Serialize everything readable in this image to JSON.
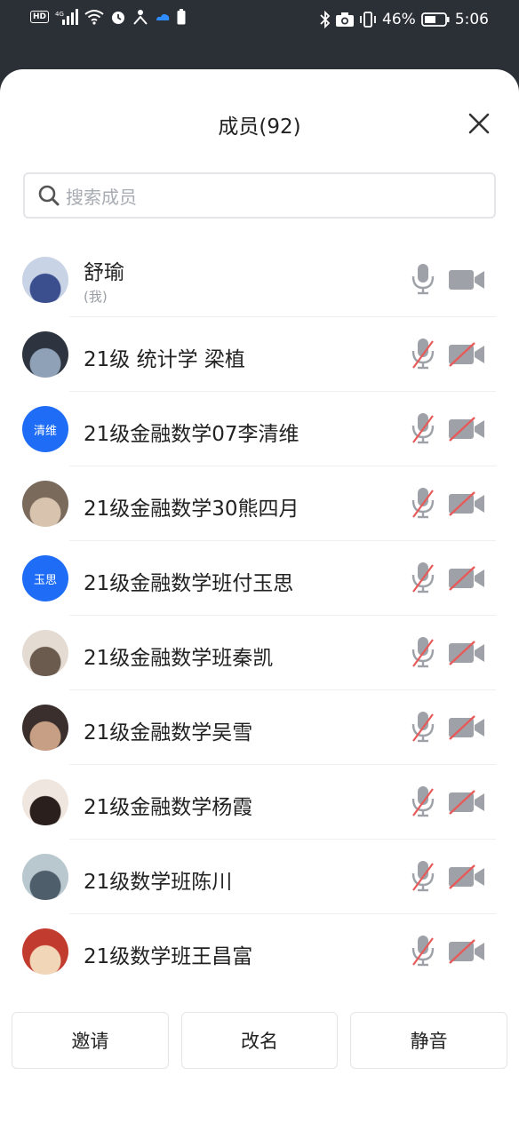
{
  "status_bar": {
    "battery_percent": "46%",
    "time": "5:06"
  },
  "header": {
    "title": "成员(92)"
  },
  "search": {
    "placeholder": "搜索成员"
  },
  "members": [
    {
      "name": "舒瑜",
      "sub": "(我)",
      "avatar_text": "",
      "mic_muted": false,
      "cam_off": false
    },
    {
      "name": "21级 统计学 梁植",
      "avatar_text": "",
      "mic_muted": true,
      "cam_off": true
    },
    {
      "name": "21级金融数学07李清维",
      "avatar_text": "清维",
      "mic_muted": true,
      "cam_off": true
    },
    {
      "name": "21级金融数学30熊四月",
      "avatar_text": "",
      "mic_muted": true,
      "cam_off": true
    },
    {
      "name": "21级金融数学班付玉思",
      "avatar_text": "玉思",
      "mic_muted": true,
      "cam_off": true
    },
    {
      "name": "21级金融数学班秦凯",
      "avatar_text": "",
      "mic_muted": true,
      "cam_off": true
    },
    {
      "name": "21级金融数学吴雪",
      "avatar_text": "",
      "mic_muted": true,
      "cam_off": true
    },
    {
      "name": "21级金融数学杨霞",
      "avatar_text": "",
      "mic_muted": true,
      "cam_off": true
    },
    {
      "name": "21级数学班陈川",
      "avatar_text": "",
      "mic_muted": true,
      "cam_off": true
    },
    {
      "name": "21级数学班王昌富",
      "avatar_text": "",
      "mic_muted": true,
      "cam_off": true
    }
  ],
  "actions": {
    "invite": "邀请",
    "rename": "改名",
    "mute": "静音"
  },
  "colors": {
    "accent": "#1f6df6",
    "muted_red": "#e65a5a",
    "icon_gray": "#9ea2a8"
  }
}
